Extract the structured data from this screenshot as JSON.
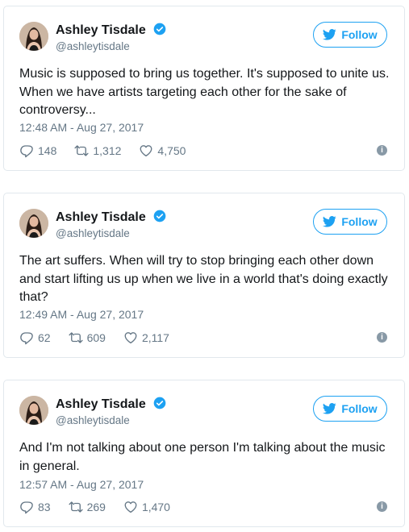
{
  "accent_color": "#1da1f2",
  "tweets": [
    {
      "name": "Ashley Tisdale",
      "handle": "@ashleytisdale",
      "follow_label": "Follow",
      "text": "Music is supposed to bring us together. It's supposed to unite us. When we have artists targeting each other for the sake of controversy...",
      "timestamp": "12:48 AM - Aug 27, 2017",
      "replies": "148",
      "retweets": "1,312",
      "likes": "4,750"
    },
    {
      "name": "Ashley Tisdale",
      "handle": "@ashleytisdale",
      "follow_label": "Follow",
      "text": "The art suffers. When will try to stop bringing each other down and start lifting us up when we live in a world that's doing exactly that?",
      "timestamp": "12:49 AM - Aug 27, 2017",
      "replies": "62",
      "retweets": "609",
      "likes": "2,117"
    },
    {
      "name": "Ashley Tisdale",
      "handle": "@ashleytisdale",
      "follow_label": "Follow",
      "text": "And I'm not talking about one person I'm talking about the music in general.",
      "timestamp": "12:57 AM - Aug 27, 2017",
      "replies": "83",
      "retweets": "269",
      "likes": "1,470"
    }
  ],
  "icons": {
    "verified": "verified-badge-icon",
    "follow": "twitter-bird-icon",
    "reply": "reply-icon",
    "retweet": "retweet-icon",
    "like": "heart-icon",
    "info": "info-icon"
  }
}
